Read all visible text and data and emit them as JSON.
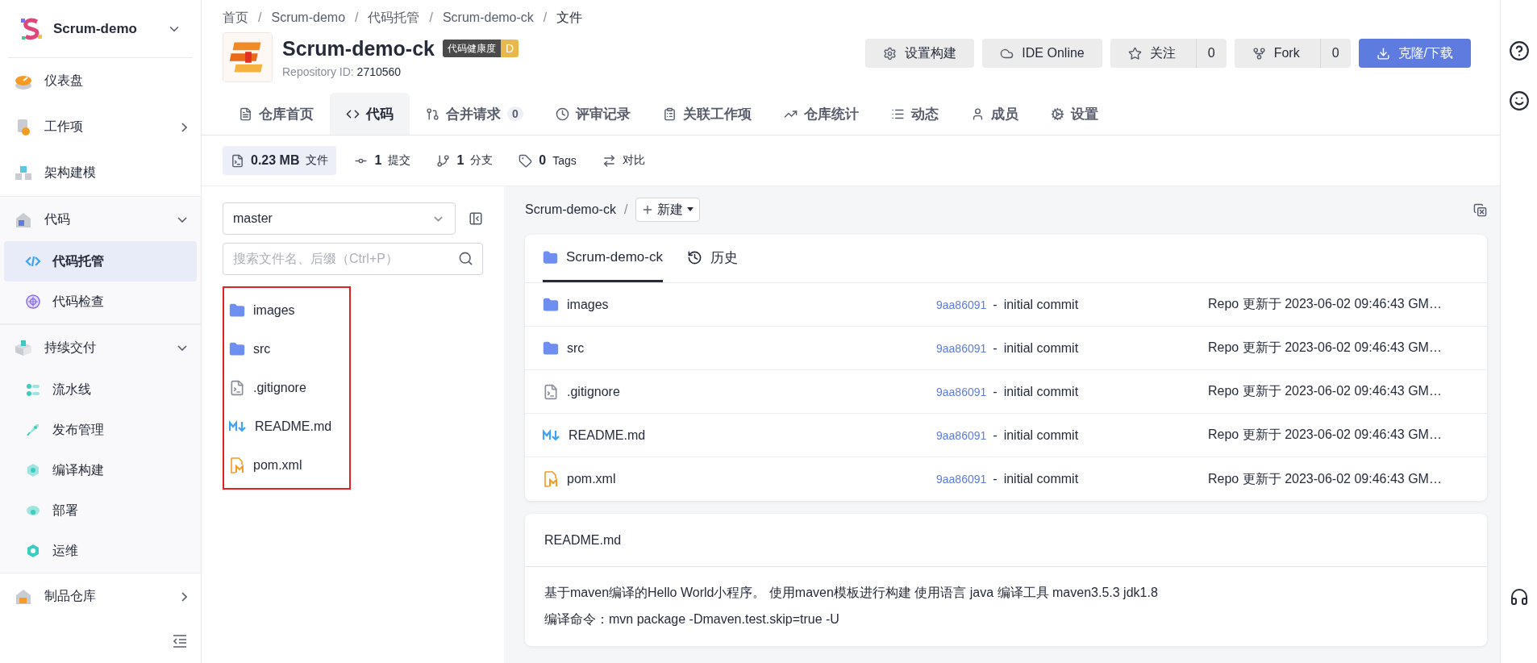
{
  "sidebar": {
    "project": "Scrum-demo",
    "items": [
      {
        "label": "仪表盘",
        "kind": "link",
        "selected": false
      },
      {
        "label": "工作项",
        "kind": "menu",
        "selected": false,
        "expanded": false
      },
      {
        "label": "架构建模",
        "kind": "link",
        "selected": false
      },
      {
        "label": "代码",
        "kind": "menu",
        "selected": false,
        "expanded": true,
        "children": [
          {
            "label": "代码托管",
            "selected": true
          },
          {
            "label": "代码检查",
            "selected": false
          }
        ]
      },
      {
        "label": "持续交付",
        "kind": "menu",
        "selected": false,
        "expanded": true,
        "children": [
          {
            "label": "流水线",
            "selected": false
          },
          {
            "label": "发布管理",
            "selected": false
          },
          {
            "label": "编译构建",
            "selected": false
          },
          {
            "label": "部署",
            "selected": false
          },
          {
            "label": "运维",
            "selected": false
          }
        ]
      },
      {
        "label": "制品仓库",
        "kind": "menu",
        "selected": false,
        "expanded": false
      }
    ]
  },
  "breadcrumb": [
    {
      "text": "首页",
      "kind": "link"
    },
    {
      "text": "/",
      "kind": "separator"
    },
    {
      "text": "Scrum-demo",
      "kind": "link"
    },
    {
      "text": "/",
      "kind": "separator"
    },
    {
      "text": "代码托管",
      "kind": "link"
    },
    {
      "text": "/",
      "kind": "separator"
    },
    {
      "text": "Scrum-demo-ck",
      "kind": "link"
    },
    {
      "text": "/",
      "kind": "separator"
    },
    {
      "text": "文件",
      "kind": "current"
    }
  ],
  "repo": {
    "name": "Scrum-demo-ck",
    "health_label": "代码健康度",
    "health_grade": "D",
    "id_label": "Repository ID:",
    "id": "2710560"
  },
  "actions": [
    {
      "label": "设置构建",
      "kind": "plain"
    },
    {
      "label": "IDE Online",
      "kind": "plain"
    },
    {
      "label": "关注",
      "kind": "count",
      "count": "0"
    },
    {
      "label": "Fork",
      "kind": "count",
      "count": "0"
    },
    {
      "label": "克隆/下载",
      "kind": "primary"
    }
  ],
  "tabs": [
    {
      "label": "仓库首页",
      "selected": false
    },
    {
      "label": "代码",
      "selected": true
    },
    {
      "label": "合并请求",
      "count": "0",
      "selected": false
    },
    {
      "label": "评审记录",
      "selected": false
    },
    {
      "label": "关联工作项",
      "selected": false
    },
    {
      "label": "仓库统计",
      "selected": false
    },
    {
      "label": "动态",
      "selected": false
    },
    {
      "label": "成员",
      "selected": false
    },
    {
      "label": "设置",
      "selected": false
    }
  ],
  "stats": [
    {
      "value": "0.23 MB",
      "label": "文件",
      "selected": true
    },
    {
      "value": "1",
      "label": "提交",
      "selected": false
    },
    {
      "value": "1",
      "label": "分支",
      "selected": false
    },
    {
      "value": "0",
      "label": "Tags",
      "selected": false
    },
    {
      "label": "对比",
      "selected": false
    }
  ],
  "file_panel": {
    "branch": "master",
    "search_placeholder": "搜索文件名、后缀（Ctrl+P）",
    "tree_marked": true,
    "tree": [
      {
        "name": "images",
        "kind": "folder"
      },
      {
        "name": "src",
        "kind": "folder"
      },
      {
        "name": ".gitignore",
        "kind": "file"
      },
      {
        "name": "README.md",
        "kind": "markdown"
      },
      {
        "name": "pom.xml",
        "kind": "maven"
      }
    ]
  },
  "path": {
    "root": "Scrum-demo-ck",
    "separator": "/",
    "new_label": "新建"
  },
  "files_card": {
    "tabs": [
      {
        "label": "Scrum-demo-ck",
        "selected": true
      },
      {
        "label": "历史",
        "selected": false
      }
    ],
    "rows": [
      {
        "name": "images",
        "kind": "folder",
        "commit": "9aa86091",
        "dash": "-",
        "message": "initial commit",
        "updated": "Repo 更新于 2023-06-02 09:46:43 GM…"
      },
      {
        "name": "src",
        "kind": "folder",
        "commit": "9aa86091",
        "dash": "-",
        "message": "initial commit",
        "updated": "Repo 更新于 2023-06-02 09:46:43 GM…"
      },
      {
        "name": ".gitignore",
        "kind": "file",
        "commit": "9aa86091",
        "dash": "-",
        "message": "initial commit",
        "updated": "Repo 更新于 2023-06-02 09:46:43 GM…"
      },
      {
        "name": "README.md",
        "kind": "markdown",
        "commit": "9aa86091",
        "dash": "-",
        "message": "initial commit",
        "updated": "Repo 更新于 2023-06-02 09:46:43 GM…"
      },
      {
        "name": "pom.xml",
        "kind": "maven",
        "commit": "9aa86091",
        "dash": "-",
        "message": "initial commit",
        "updated": "Repo 更新于 2023-06-02 09:46:43 GM…"
      }
    ]
  },
  "readme": {
    "title": "README.md",
    "lines": [
      "基于maven编译的Hello World小程序。 使用maven模板进行构建 使用语言 java 编译工具 maven3.5.3 jdk1.8",
      "编译命令：mvn package -Dmaven.test.skip=true -U"
    ]
  }
}
